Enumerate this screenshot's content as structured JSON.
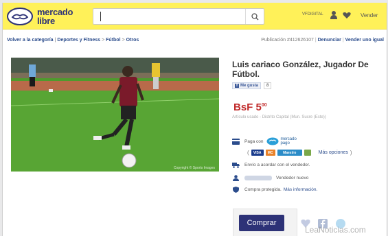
{
  "header": {
    "logo_line1": "mercado",
    "logo_line2": "libre",
    "search_placeholder": "",
    "user_label": "VFDIGITAL",
    "sell_label": "Vender"
  },
  "breadcrumb": {
    "back": "Volver a la categoría",
    "items": [
      "Deportes y Fitness",
      "Fútbol",
      "Otros"
    ]
  },
  "publication": {
    "label": "Publicación #412626107",
    "report": "Denunciar",
    "sell_same": "Vender uno igual"
  },
  "photo": {
    "caption": "Copyright © Sports Images"
  },
  "product": {
    "title": "Luis cariaco González, Jugador De Fútbol.",
    "like_label": "Me gusta",
    "like_count": "8",
    "price_currency": "BsF",
    "price_value": "5",
    "price_cents": "00",
    "condition": "Artículo usado - Distrito Capital (Mun. Sucre (Este))"
  },
  "payment": {
    "pay_with": "Paga con",
    "mp_line1": "mercado",
    "mp_line2": "pago",
    "cards": [
      "VISA",
      "MC",
      "Maestro"
    ],
    "more_options": "Más opciones",
    "shipping": "Envío a acordar con el vendedor.",
    "seller": "Vendedor nuevo",
    "protected": "Compra protegida.",
    "more_info": "Más información."
  },
  "buy": {
    "label": "Comprar"
  },
  "watermark": "LeaNoticias.com",
  "colors": {
    "header_bg": "#fff159",
    "brand_blue": "#2d3277",
    "price_red": "#c02a2a",
    "link_blue": "#2b4c8c"
  }
}
